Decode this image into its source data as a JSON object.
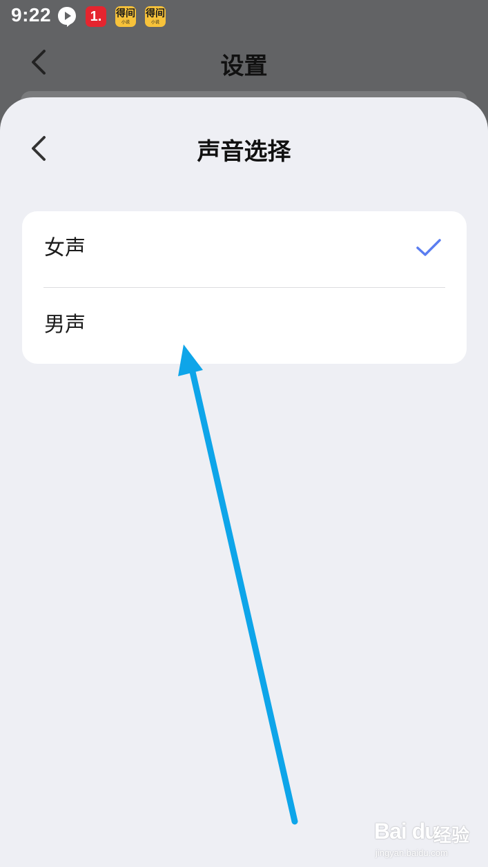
{
  "status_bar": {
    "time": "9:22",
    "icons": [
      {
        "name": "play-app-icon"
      },
      {
        "name": "red-app-icon",
        "text": "1."
      },
      {
        "name": "novel-app-icon",
        "text": "得间",
        "subtext": "小说"
      },
      {
        "name": "novel-app-icon-2",
        "text": "得间",
        "subtext": "小说"
      }
    ]
  },
  "background_page": {
    "title": "设置"
  },
  "sheet": {
    "title": "声音选择",
    "options": [
      {
        "label": "女声",
        "selected": true
      },
      {
        "label": "男声",
        "selected": false
      }
    ],
    "accent_color": "#5a7df0"
  },
  "annotation": {
    "arrow_color": "#0ea5e9"
  },
  "watermark": {
    "logo": "Bai du",
    "brand": "经验",
    "url": "jingyan.baidu.com"
  }
}
